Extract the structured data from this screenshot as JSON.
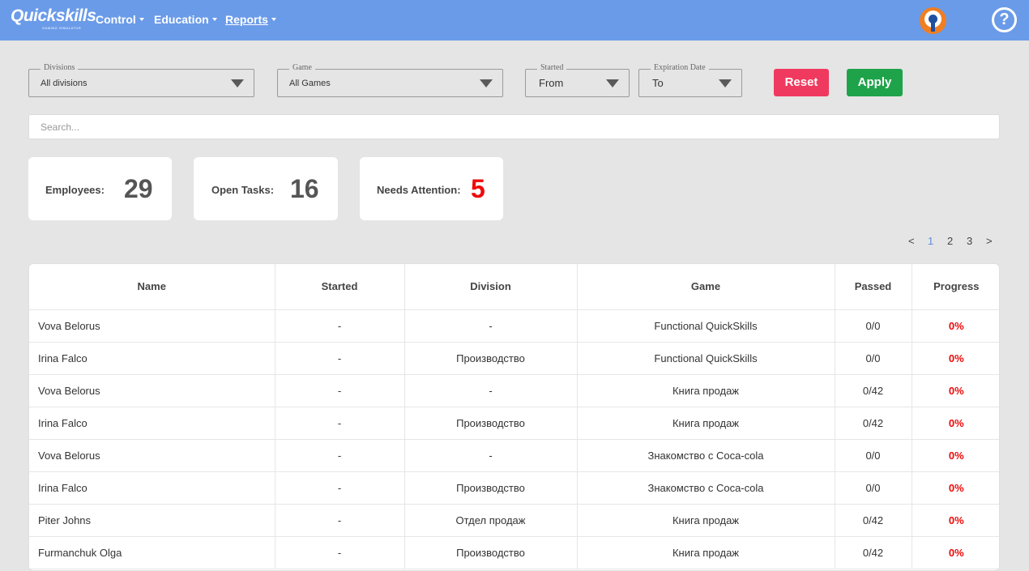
{
  "header": {
    "logo": "Quickskills",
    "logo_sub": "GAMING SIMULATOR",
    "nav": [
      {
        "label": "Control"
      },
      {
        "label": "Education"
      },
      {
        "label": "Reports"
      }
    ],
    "help_symbol": "?"
  },
  "filters": {
    "divisions": {
      "legend": "Divisions",
      "value": "All divisions"
    },
    "game": {
      "legend": "Game",
      "value": "All Games"
    },
    "started": {
      "legend": "Started",
      "value": "From"
    },
    "expiration": {
      "legend": "Expiration Date",
      "value": "To"
    },
    "reset_label": "Reset",
    "apply_label": "Apply",
    "search_placeholder": "Search..."
  },
  "stats": {
    "employees": {
      "label": "Employees:",
      "value": "29"
    },
    "open_tasks": {
      "label": "Open Tasks:",
      "value": "16"
    },
    "needs_attention": {
      "label": "Needs Attention:",
      "value": "5"
    }
  },
  "pagination": {
    "prev": "<",
    "pages": [
      "1",
      "2",
      "3"
    ],
    "current": "1",
    "next": ">"
  },
  "table": {
    "columns": [
      "Name",
      "Started",
      "Division",
      "Game",
      "Passed",
      "Progress"
    ],
    "rows": [
      {
        "name": "Vova Belorus",
        "started": "-",
        "division": "-",
        "game": "Functional QuickSkills",
        "passed": "0/0",
        "progress": "0%"
      },
      {
        "name": "Irina Falco",
        "started": "-",
        "division": "Производство",
        "game": "Functional QuickSkills",
        "passed": "0/0",
        "progress": "0%"
      },
      {
        "name": "Vova Belorus",
        "started": "-",
        "division": "-",
        "game": "Книга продаж",
        "passed": "0/42",
        "progress": "0%"
      },
      {
        "name": "Irina Falco",
        "started": "-",
        "division": "Производство",
        "game": "Книга продаж",
        "passed": "0/42",
        "progress": "0%"
      },
      {
        "name": "Vova Belorus",
        "started": "-",
        "division": "-",
        "game": "Знакомство с Coca-cola",
        "passed": "0/0",
        "progress": "0%"
      },
      {
        "name": "Irina Falco",
        "started": "-",
        "division": "Производство",
        "game": "Знакомство с Coca-cola",
        "passed": "0/0",
        "progress": "0%"
      },
      {
        "name": "Piter Johns",
        "started": "-",
        "division": "Отдел продаж",
        "game": "Книга продаж",
        "passed": "0/42",
        "progress": "0%"
      },
      {
        "name": "Furmanchuk Olga",
        "started": "-",
        "division": "Производство",
        "game": "Книга продаж",
        "passed": "0/42",
        "progress": "0%"
      }
    ]
  },
  "colors": {
    "header_bg": "#6a9be8",
    "reset": "#f0395e",
    "apply": "#1fa34a",
    "alert": "#ee0a0a",
    "active_page": "#5b8ee0"
  }
}
